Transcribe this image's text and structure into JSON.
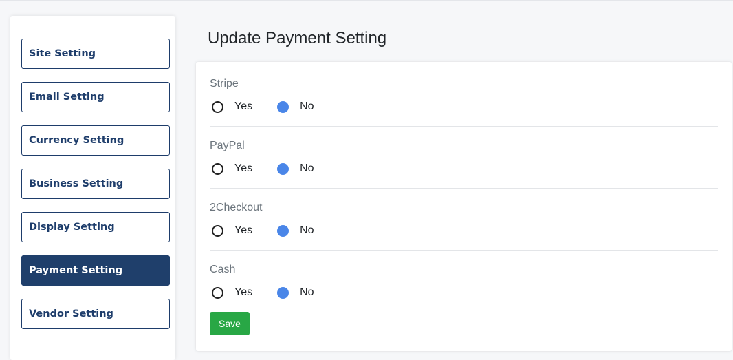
{
  "sidebar": {
    "items": [
      {
        "label": "Site Setting",
        "active": false
      },
      {
        "label": "Email Setting",
        "active": false
      },
      {
        "label": "Currency Setting",
        "active": false
      },
      {
        "label": "Business Setting",
        "active": false
      },
      {
        "label": "Display Setting",
        "active": false
      },
      {
        "label": "Payment Setting",
        "active": true
      },
      {
        "label": "Vendor Setting",
        "active": false
      }
    ]
  },
  "main": {
    "title": "Update Payment Setting",
    "sections": [
      {
        "label": "Stripe",
        "yes_label": "Yes",
        "no_label": "No",
        "selected": "No"
      },
      {
        "label": "PayPal",
        "yes_label": "Yes",
        "no_label": "No",
        "selected": "No"
      },
      {
        "label": "2Checkout",
        "yes_label": "Yes",
        "no_label": "No",
        "selected": "No"
      },
      {
        "label": "Cash",
        "yes_label": "Yes",
        "no_label": "No",
        "selected": "No"
      }
    ],
    "save_label": "Save"
  },
  "colors": {
    "primary_navy": "#1f3f6b",
    "radio_checked": "#4a86e8",
    "save_green": "#28a745"
  }
}
